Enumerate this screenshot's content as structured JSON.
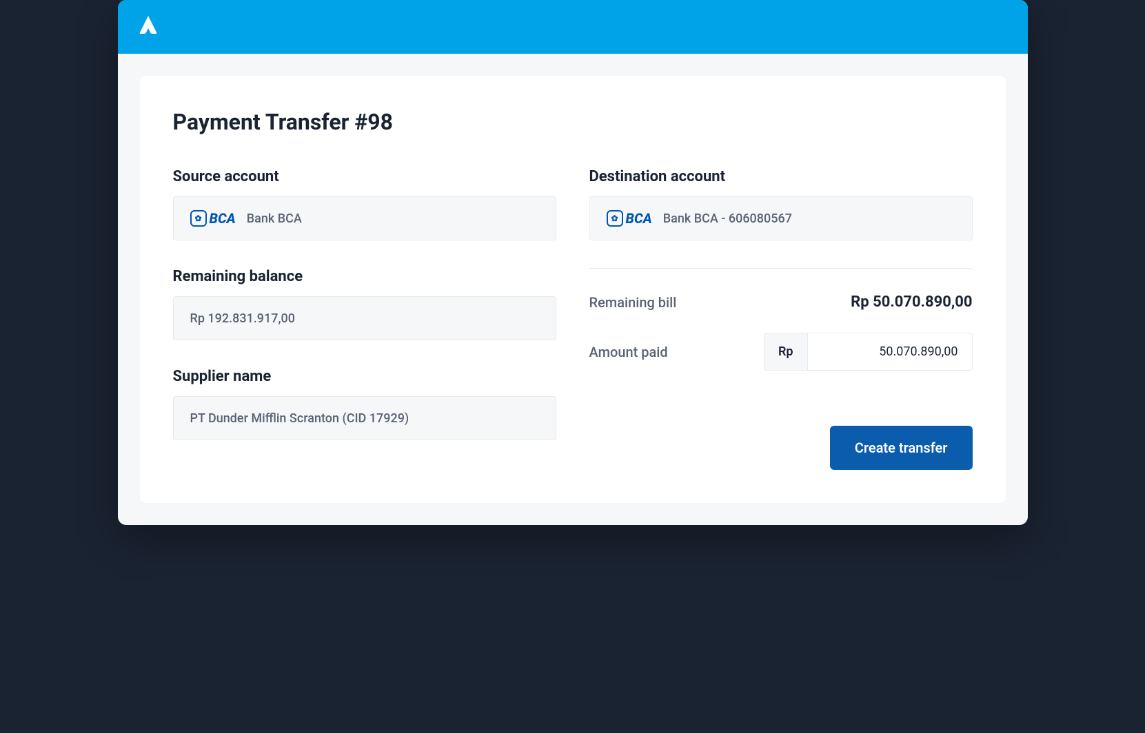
{
  "page": {
    "title": "Payment Transfer #98"
  },
  "source_account": {
    "label": "Source account",
    "bank_logo_text": "BCA",
    "value": "Bank BCA"
  },
  "destination_account": {
    "label": "Destination account",
    "bank_logo_text": "BCA",
    "value": "Bank BCA - 606080567"
  },
  "remaining_balance": {
    "label": "Remaining balance",
    "value": "Rp 192.831.917,00"
  },
  "supplier": {
    "label": "Supplier name",
    "value": "PT Dunder Mifflin Scranton (CID 17929)"
  },
  "remaining_bill": {
    "label": "Remaining bill",
    "value": "Rp 50.070.890,00"
  },
  "amount_paid": {
    "label": "Amount paid",
    "currency": "Rp",
    "value": "50.070.890,00"
  },
  "actions": {
    "create_transfer": "Create transfer"
  }
}
